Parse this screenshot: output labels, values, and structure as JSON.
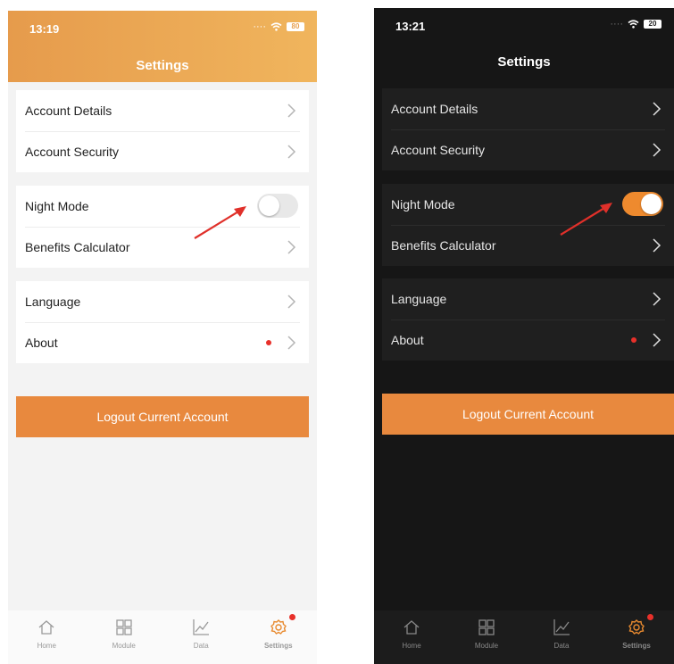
{
  "screens": [
    {
      "theme": "light",
      "time": "13:19",
      "battery": "80",
      "title": "Settings",
      "groups": [
        [
          "Account Details",
          "Account Security"
        ],
        [
          "Night Mode",
          "Benefits Calculator"
        ],
        [
          "Language",
          "About"
        ]
      ],
      "night_mode_on": false,
      "logout_label": "Logout Current Account",
      "tabs": [
        "Home",
        "Module",
        "Data",
        "Settings"
      ]
    },
    {
      "theme": "dark",
      "time": "13:21",
      "battery": "20",
      "title": "Settings",
      "groups": [
        [
          "Account Details",
          "Account Security"
        ],
        [
          "Night Mode",
          "Benefits Calculator"
        ],
        [
          "Language",
          "About"
        ]
      ],
      "night_mode_on": true,
      "logout_label": "Logout Current Account",
      "tabs": [
        "Home",
        "Module",
        "Data",
        "Settings"
      ]
    }
  ],
  "colors": {
    "accent": "#e8893e",
    "header_gradient_start": "#e69b4c",
    "header_gradient_end": "#f0b55d",
    "badge": "#e8302a",
    "arrow": "#e0302a",
    "dark_bg": "#161616",
    "dark_card": "#1f1f1f"
  },
  "icons": [
    "wifi-icon",
    "battery-icon",
    "chevron-right-icon",
    "home-icon",
    "module-grid-icon",
    "data-chart-icon",
    "settings-gear-icon",
    "red-arrow-annotation"
  ]
}
